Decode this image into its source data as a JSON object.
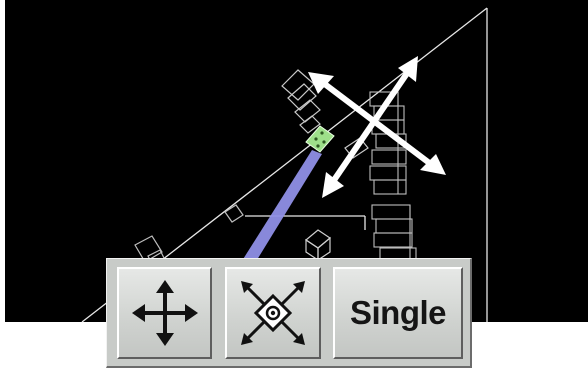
{
  "toolbar": {
    "move_icon": "move-arrows-icon",
    "transform_icon": "scale-rotate-icon",
    "single_label": "Single"
  },
  "colors": {
    "viewport_background": "#000000",
    "wireframe": "#e8e8e8",
    "selected_highlight": "#9ee08a",
    "beam": "#8f8fe6",
    "overlay_arrows": "#ffffff",
    "toolbar_face": "#c8cbc8"
  }
}
